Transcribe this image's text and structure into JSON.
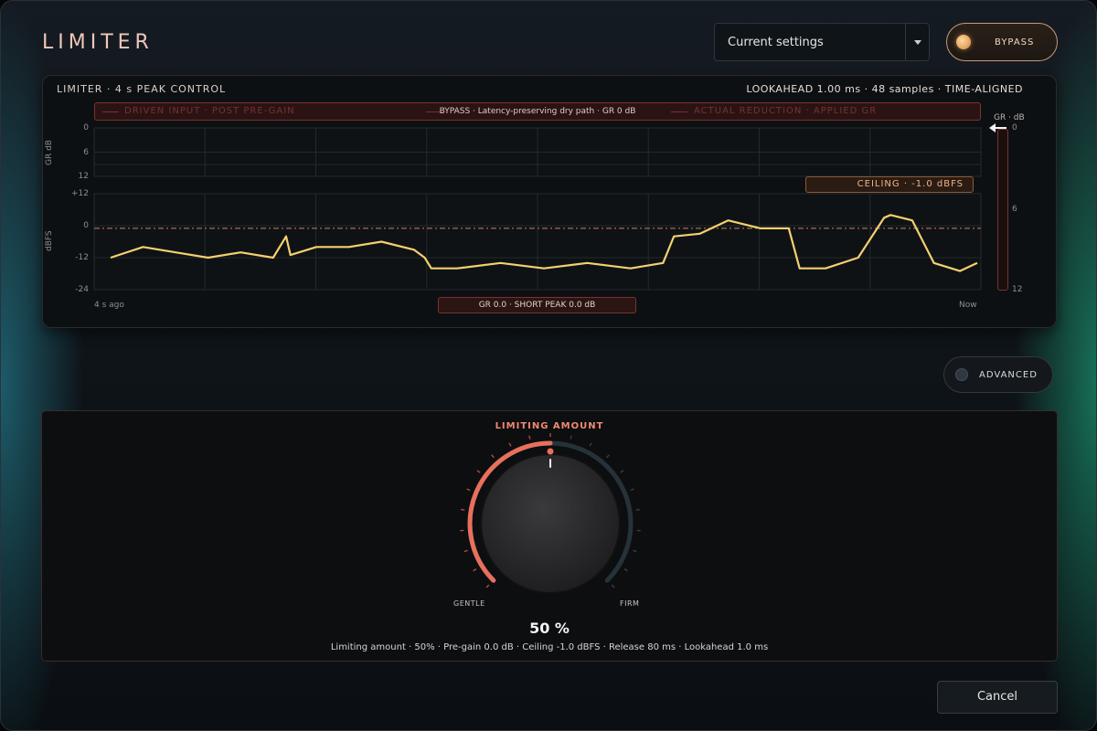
{
  "header": {
    "title": "LIMITER",
    "preset_value": "Current settings",
    "bypass_label": "BYPASS"
  },
  "meter": {
    "left_label": "LIMITER · 4 s PEAK CONTROL",
    "right_label": "LOOKAHEAD 1.00 ms · 48 samples · TIME-ALIGNED",
    "banner_ghost_left": "DRIVEN INPUT · POST PRE-GAIN",
    "banner_center": "BYPASS · Latency-preserving dry path · GR 0 dB",
    "banner_ghost_right": "ACTUAL REDUCTION · APPLIED GR",
    "gr_axis_title": "GR dB",
    "gr_ticks": [
      "0",
      "6",
      "12"
    ],
    "dbfs_axis_title": "dBFS",
    "dbfs_ticks": [
      "+12",
      "0",
      "-12",
      "-24"
    ],
    "ceiling_label": "CEILING · -1.0 dBFS",
    "time_start": "4 s ago",
    "time_end": "Now",
    "status_tag": "GR 0.0 · SHORT PEAK 0.0 dB",
    "side_title": "GR · dB",
    "side_ticks": [
      "0",
      "6",
      "12"
    ]
  },
  "chart_data": {
    "type": "line",
    "x": [
      0,
      0.15,
      0.3,
      0.45,
      0.6,
      0.75,
      0.81,
      0.83,
      0.95,
      1.1,
      1.25,
      1.4,
      1.45,
      1.48,
      1.6,
      1.8,
      2.0,
      2.2,
      2.4,
      2.55,
      2.6,
      2.72,
      2.85,
      3.0,
      3.13,
      3.18,
      3.3,
      3.45,
      3.57,
      3.6,
      3.7,
      3.8,
      3.92,
      4.0
    ],
    "series": [
      {
        "values": [
          -12,
          -8,
          -10,
          -12,
          -10,
          -12,
          -4,
          -11,
          -8,
          -8,
          -6,
          -9,
          -12,
          -16,
          -16,
          -14,
          -16,
          -14,
          -16,
          -14,
          -4,
          -3,
          2,
          -1,
          -1,
          -16,
          -16,
          -12,
          3,
          4,
          2,
          -14,
          -17,
          -14
        ]
      }
    ],
    "ceiling": -1.0,
    "x_range": [
      0,
      4
    ],
    "ylim": [
      -24,
      12
    ],
    "yticks": [
      12,
      0,
      -12,
      -24
    ],
    "gr_range": [
      0,
      12
    ],
    "grid": true,
    "colors": {
      "line": "#f4d06f",
      "ceiling": "#c9835c"
    }
  },
  "advanced": {
    "label": "ADVANCED"
  },
  "knob": {
    "title": "LIMITING AMOUNT",
    "value_percent": 50,
    "min_label": "GENTLE",
    "max_label": "FIRM",
    "value_text": "50 %",
    "summary": "Limiting amount · 50% · Pre-gain 0.0 dB · Ceiling -1.0 dBFS · Release 80 ms · Lookahead 1.0 ms"
  },
  "footer": {
    "cancel_label": "Cancel"
  },
  "colors": {
    "accent": "#e8705c",
    "amber": "#e0a05c",
    "trace": "#f4d06f"
  }
}
